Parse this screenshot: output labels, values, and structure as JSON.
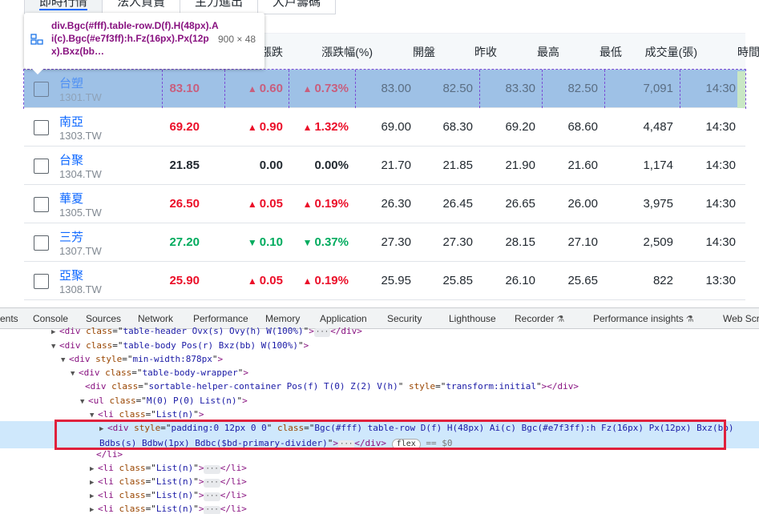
{
  "tabs": [
    {
      "label": "即時行情",
      "active": true
    },
    {
      "label": "法人買賣",
      "active": false
    },
    {
      "label": "主力進出",
      "active": false
    },
    {
      "label": "大戶籌碼",
      "active": false
    }
  ],
  "tooltip": {
    "selector": "div.Bgc(#fff).table-row.D(f).H(48px).Ai(c).Bgc(#e7f3ff):h.Fz(16px).Px(12px).Bxz(bb…",
    "dims": "900 × 48",
    "icon": "inspect-element-icon"
  },
  "headers": [
    "漲跌",
    "漲跌幅(%)",
    "開盤",
    "昨收",
    "最高",
    "最低",
    "成交量(張)",
    "時間"
  ],
  "rows": [
    {
      "name": "台塑",
      "code": "1301.TW",
      "price": "83.10",
      "change": "0.60",
      "pct": "0.73%",
      "dir": "up",
      "open": "83.00",
      "prev": "82.50",
      "high": "83.30",
      "low": "82.50",
      "vol": "7,091",
      "time": "14:30",
      "highlighted": true
    },
    {
      "name": "南亞",
      "code": "1303.TW",
      "price": "69.20",
      "change": "0.90",
      "pct": "1.32%",
      "dir": "up",
      "open": "69.00",
      "prev": "68.30",
      "high": "69.20",
      "low": "68.60",
      "vol": "4,487",
      "time": "14:30",
      "highlighted": false
    },
    {
      "name": "台聚",
      "code": "1304.TW",
      "price": "21.85",
      "change": "0.00",
      "pct": "0.00%",
      "dir": "flat",
      "open": "21.70",
      "prev": "21.85",
      "high": "21.90",
      "low": "21.60",
      "vol": "1,174",
      "time": "14:30",
      "highlighted": false
    },
    {
      "name": "華夏",
      "code": "1305.TW",
      "price": "26.50",
      "change": "0.05",
      "pct": "0.19%",
      "dir": "up",
      "open": "26.30",
      "prev": "26.45",
      "high": "26.65",
      "low": "26.00",
      "vol": "3,975",
      "time": "14:30",
      "highlighted": false
    },
    {
      "name": "三芳",
      "code": "1307.TW",
      "price": "27.20",
      "change": "0.10",
      "pct": "0.37%",
      "dir": "down",
      "open": "27.30",
      "prev": "27.30",
      "high": "28.15",
      "low": "27.10",
      "vol": "2,509",
      "time": "14:30",
      "highlighted": false
    },
    {
      "name": "亞聚",
      "code": "1308.TW",
      "price": "25.90",
      "change": "0.05",
      "pct": "0.19%",
      "dir": "up",
      "open": "25.95",
      "prev": "25.85",
      "high": "26.10",
      "low": "25.65",
      "vol": "822",
      "time": "13:30",
      "highlighted": false
    }
  ],
  "devtools": {
    "tabs": [
      "ents",
      "Console",
      "Sources",
      "Network",
      "Performance",
      "Memory",
      "Application",
      "Security",
      "Lighthouse",
      "Recorder",
      "Performance insights",
      "Web Scr"
    ],
    "lines": [
      {
        "tag": "div",
        "attrs": [
          [
            "class",
            "table-header Ovx(s) Ovy(h) W(100%)"
          ]
        ],
        "collapsed": true,
        "close": "</div>"
      },
      {
        "tag": "div",
        "attrs": [
          [
            "class",
            "table-body Pos(r) Bxz(bb) W(100%)"
          ]
        ],
        "open": true
      },
      {
        "tag": "div",
        "attrs": [
          [
            "style",
            "min-width:878px"
          ]
        ],
        "open": true
      },
      {
        "tag": "div",
        "attrs": [
          [
            "class",
            "table-body-wrapper"
          ]
        ],
        "open": true
      },
      {
        "tag": "div",
        "attrs": [
          [
            "class",
            "sortable-helper-container Pos(f) T(0) Z(2) V(h)"
          ],
          [
            "style",
            "transform:initial"
          ]
        ],
        "close": "</div>"
      },
      {
        "tag": "ul",
        "attrs": [
          [
            "class",
            "M(0) P(0) List(n)"
          ]
        ],
        "open": true
      },
      {
        "tag": "li",
        "attrs": [
          [
            "class",
            "List(n)"
          ]
        ],
        "open": true
      },
      {
        "tag": "div",
        "attrs": [
          [
            "style",
            "padding:0 12px 0 0"
          ],
          [
            "class",
            "Bgc(#fff) table-row D(f) H(48px) Ai(c) Bgc(#e7f3ff):h Fz(16px) Px(12px) Bxz(bb) Bdbs(s) Bdbw(1px) Bdbc($bd-primary-divider)"
          ]
        ],
        "collapsed": true,
        "close": "</div>",
        "selected": true,
        "pill": "flex",
        "eq": "== $0"
      },
      {
        "text": "</li>"
      },
      {
        "tag": "li",
        "attrs": [
          [
            "class",
            "List(n)"
          ]
        ],
        "collapsed": true,
        "close": "</li>"
      },
      {
        "tag": "li",
        "attrs": [
          [
            "class",
            "List(n)"
          ]
        ],
        "collapsed": true,
        "close": "</li>"
      },
      {
        "tag": "li",
        "attrs": [
          [
            "class",
            "List(n)"
          ]
        ],
        "collapsed": true,
        "close": "</li>"
      },
      {
        "tag": "li",
        "attrs": [
          [
            "class",
            "List(n)"
          ]
        ],
        "collapsed": true,
        "close": "</li>"
      }
    ]
  },
  "colors": {
    "up": "#eb0f29",
    "down": "#00ab5e",
    "link": "#0f69ff",
    "highlight": "#9ec1e6",
    "selection": "#cfe8fc",
    "annotation": "#e0213c"
  }
}
